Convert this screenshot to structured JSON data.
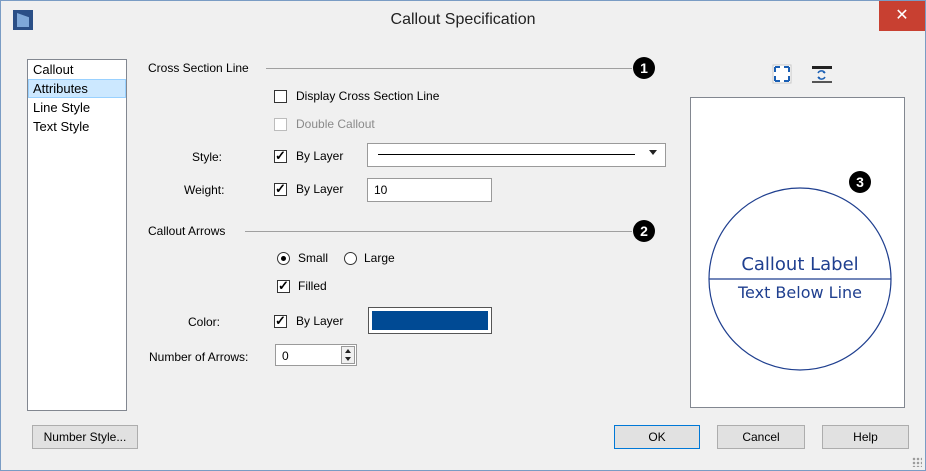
{
  "window": {
    "title": "Callout Specification",
    "close_glyph": "✕"
  },
  "sidebar": {
    "items": [
      {
        "label": "Callout",
        "selected": false
      },
      {
        "label": "Attributes",
        "selected": true
      },
      {
        "label": "Line Style",
        "selected": false
      },
      {
        "label": "Text Style",
        "selected": false
      }
    ]
  },
  "cross_section": {
    "heading": "Cross Section Line",
    "badge": "1",
    "display_label": "Display Cross Section Line",
    "display_checked": false,
    "double_label": "Double Callout",
    "double_checked": false,
    "style_label": "Style:",
    "style_bylayer_label": "By Layer",
    "style_bylayer_checked": true,
    "weight_label": "Weight:",
    "weight_bylayer_label": "By Layer",
    "weight_bylayer_checked": true,
    "weight_value": "10"
  },
  "arrows": {
    "heading": "Callout Arrows",
    "badge": "2",
    "small_label": "Small",
    "large_label": "Large",
    "size_selected": "Small",
    "filled_label": "Filled",
    "filled_checked": true,
    "color_label": "Color:",
    "color_bylayer_label": "By Layer",
    "color_bylayer_checked": true,
    "color_value": "#004a94",
    "number_label": "Number of Arrows:",
    "number_value": "0"
  },
  "preview": {
    "badge": "3",
    "label_above": "Callout Label",
    "label_below": "Text Below Line",
    "line_color": "#1f3f8f"
  },
  "icons": {
    "fit": "fit-to-window-icon",
    "swap": "swap-text-icon"
  },
  "buttons": {
    "number_style": "Number Style...",
    "ok": "OK",
    "cancel": "Cancel",
    "help": "Help"
  }
}
